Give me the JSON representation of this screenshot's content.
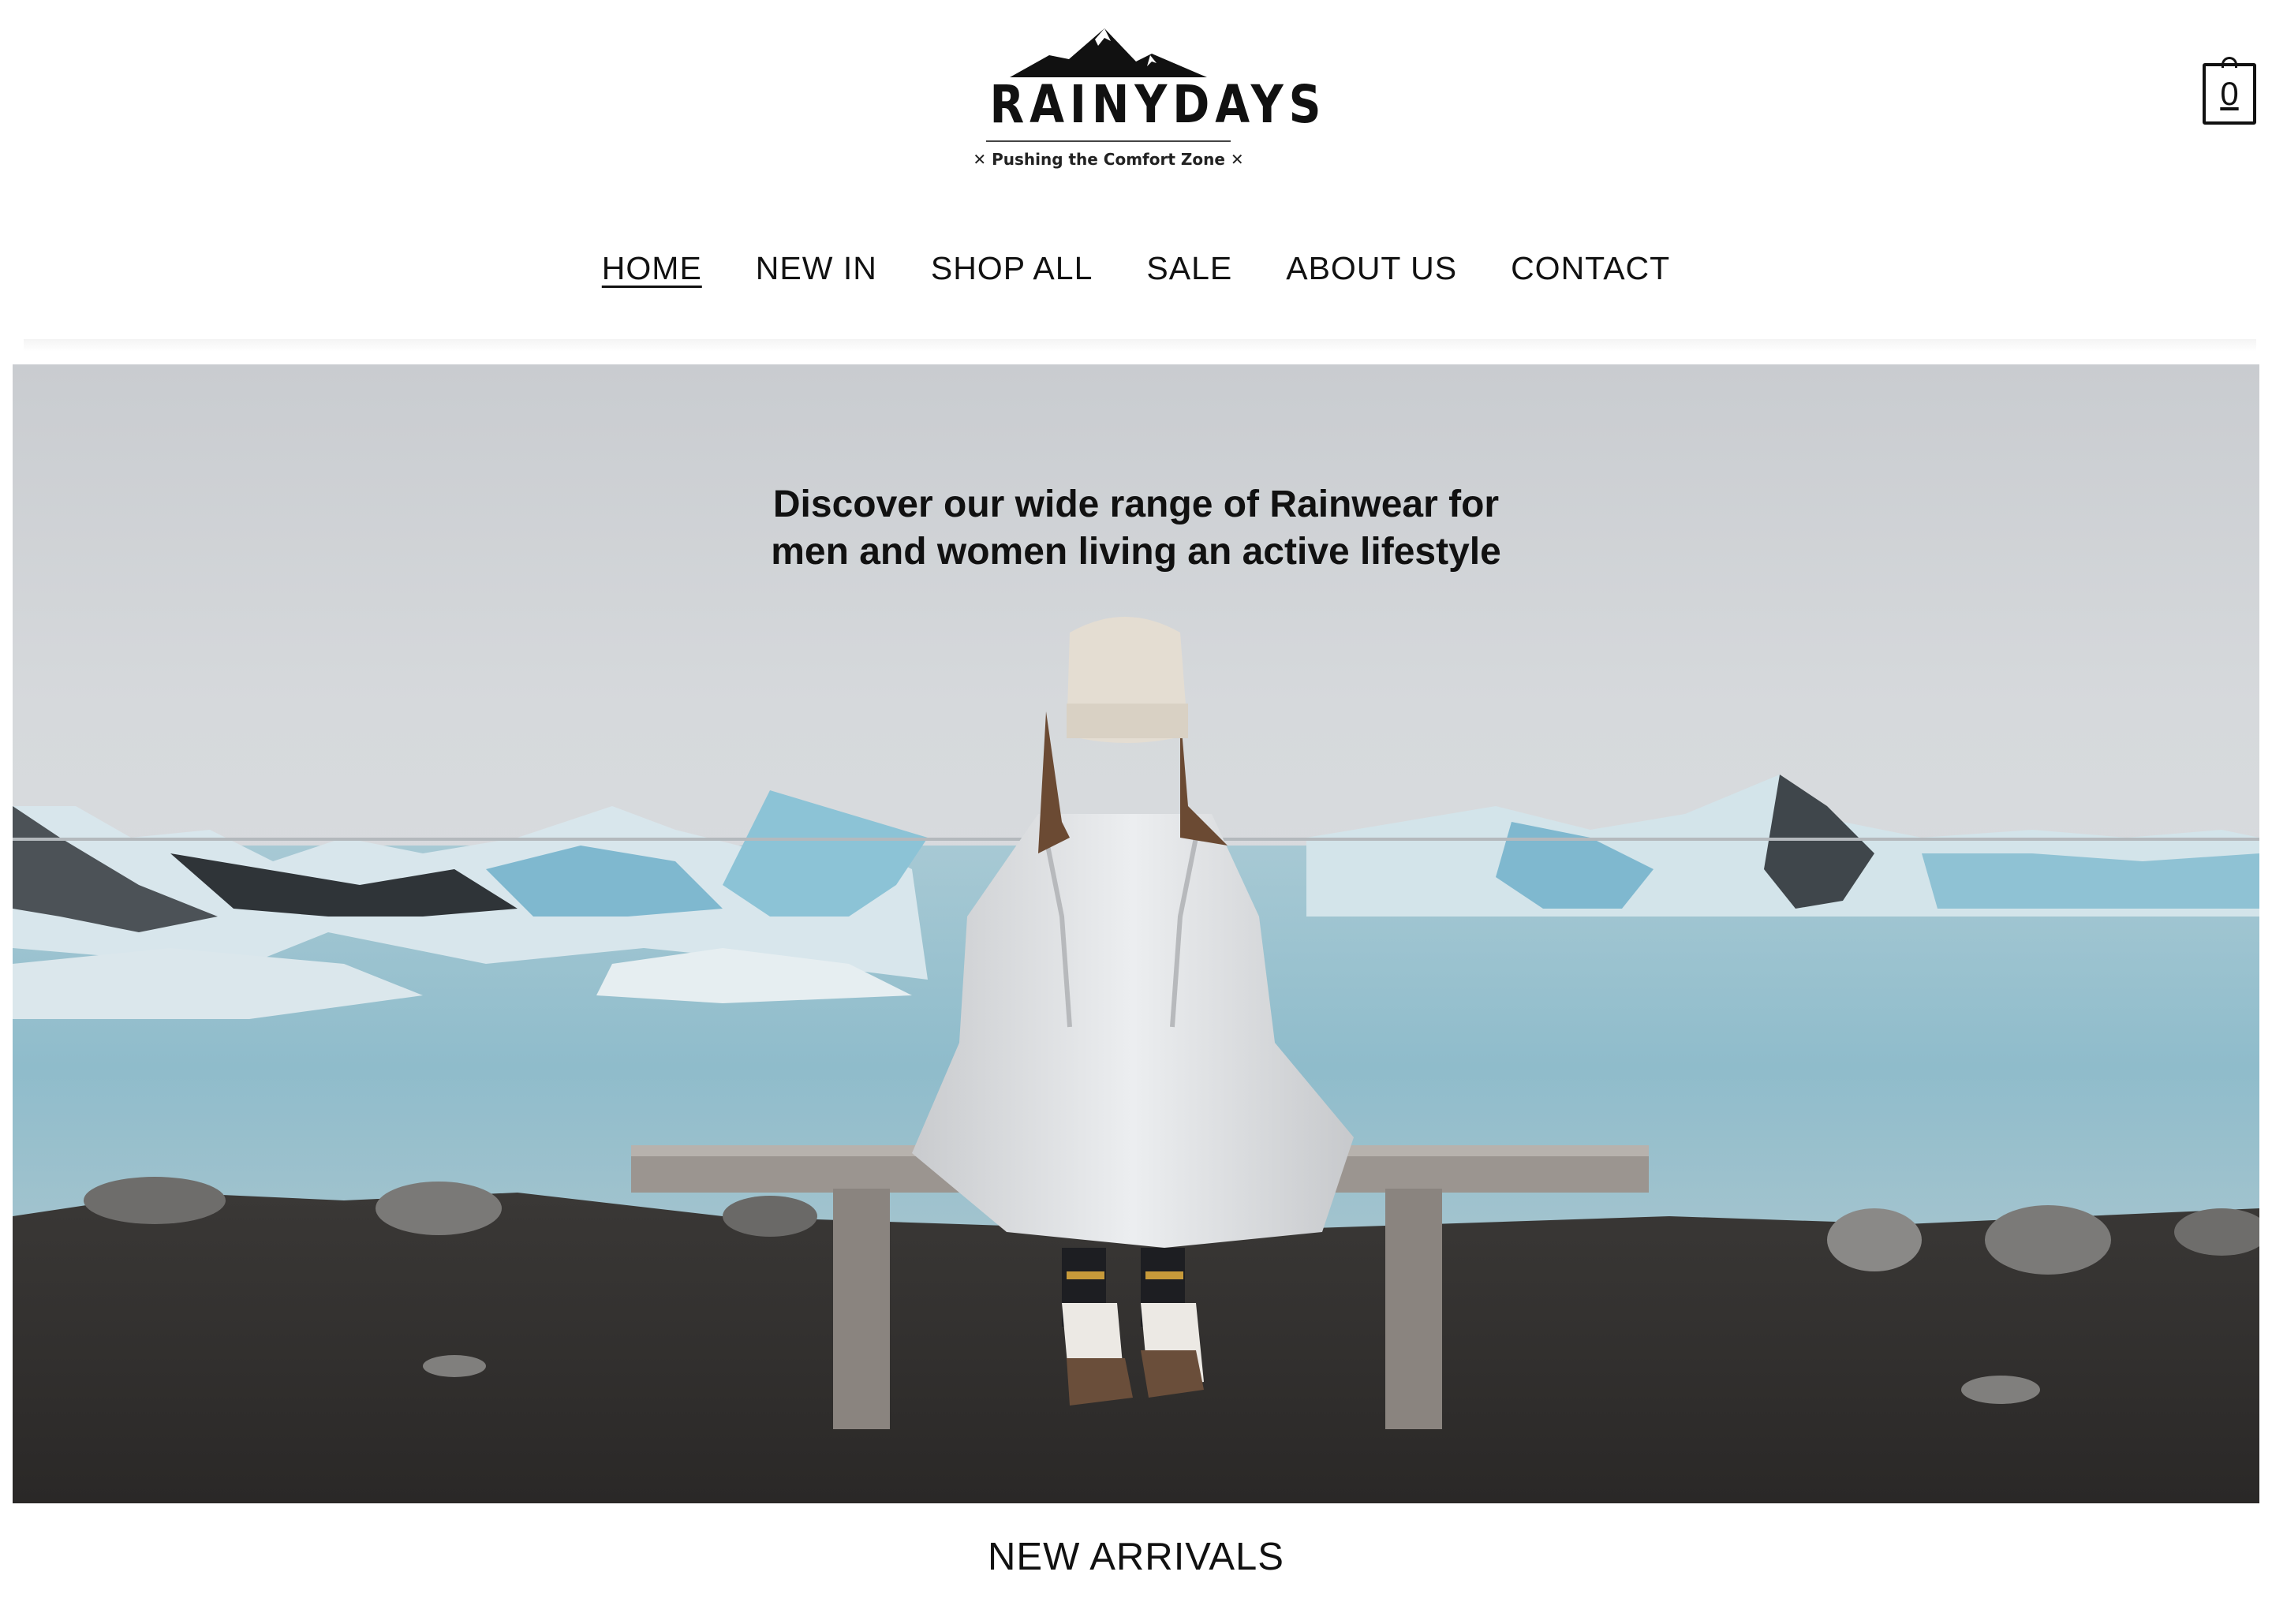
{
  "brand": {
    "name": "RAINYDAYS",
    "tagline": "✕ Pushing the Comfort Zone ✕"
  },
  "cart": {
    "count": "0"
  },
  "nav": {
    "items": [
      {
        "label": "HOME",
        "active": true
      },
      {
        "label": "NEW IN",
        "active": false
      },
      {
        "label": "SHOP ALL",
        "active": false
      },
      {
        "label": "SALE",
        "active": false
      },
      {
        "label": "ABOUT US",
        "active": false
      },
      {
        "label": "CONTACT",
        "active": false
      }
    ]
  },
  "hero": {
    "heading_line1": "Discover our wide range of Rainwear for",
    "heading_line2": "men and women living an active lifestyle"
  },
  "sections": {
    "new_arrivals_title": "NEW ARRIVALS"
  },
  "colors": {
    "text": "#111111",
    "background": "#ffffff",
    "glacier_blue": "#7fb8cf"
  }
}
